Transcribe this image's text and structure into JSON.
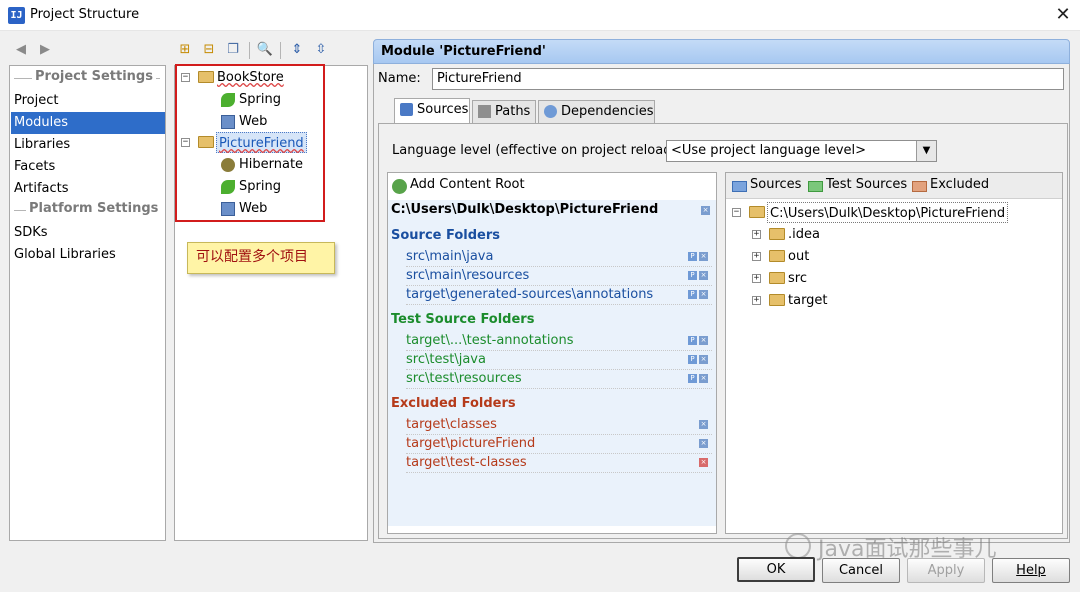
{
  "window": {
    "title": "Project Structure",
    "icon_text": "IJ"
  },
  "left_nav": {
    "project_settings_label": "Project Settings",
    "platform_settings_label": "Platform Settings",
    "items": [
      {
        "label": "Project",
        "selected": false
      },
      {
        "label": "Modules",
        "selected": true
      },
      {
        "label": "Libraries",
        "selected": false
      },
      {
        "label": "Facets",
        "selected": false
      },
      {
        "label": "Artifacts",
        "selected": false
      }
    ],
    "platform_items": [
      {
        "label": "SDKs"
      },
      {
        "label": "Global Libraries"
      }
    ]
  },
  "module_tree": {
    "modules": [
      {
        "name": "BookStore",
        "facets": [
          "Spring",
          "Web"
        ]
      },
      {
        "name": "PictureFriend",
        "selected": true,
        "facets": [
          "Hibernate",
          "Spring",
          "Web"
        ]
      }
    ],
    "annotation": "可以配置多个项目"
  },
  "module_panel": {
    "header": "Module 'PictureFriend'",
    "name_label": "Name:",
    "name_value": "PictureFriend",
    "tabs": [
      "Sources",
      "Paths",
      "Dependencies"
    ],
    "active_tab": "Sources",
    "language_level_label": "Language level (effective on project reload):",
    "language_level_value": "<Use project language level>",
    "add_content_root": "Add Content Root",
    "content_root_path": "C:\\Users\\Dulk\\Desktop\\PictureFriend",
    "source_folders_title": "Source Folders",
    "source_folders": [
      "src\\main\\java",
      "src\\main\\resources",
      "target\\generated-sources\\annotations"
    ],
    "test_source_folders_title": "Test Source Folders",
    "test_source_folders": [
      "target\\...\\test-annotations",
      "src\\test\\java",
      "src\\test\\resources"
    ],
    "excluded_folders_title": "Excluded Folders",
    "excluded_folders": [
      "target\\classes",
      "target\\pictureFriend",
      "target\\test-classes"
    ],
    "mark_as": [
      "Sources",
      "Test Sources",
      "Excluded"
    ],
    "dir_tree_root": "C:\\Users\\Dulk\\Desktop\\PictureFriend",
    "dir_tree_children": [
      ".idea",
      "out",
      "src",
      "target"
    ]
  },
  "buttons": {
    "ok": "OK",
    "cancel": "Cancel",
    "apply": "Apply",
    "help": "Help"
  },
  "watermark": "Java面试那些事儿",
  "colors": {
    "selection": "#2e6dc9",
    "source_blue": "#1a4fa0",
    "test_green": "#1b8c2c",
    "excluded_red": "#b53a1a",
    "annotation_box": "#d21c1c"
  }
}
